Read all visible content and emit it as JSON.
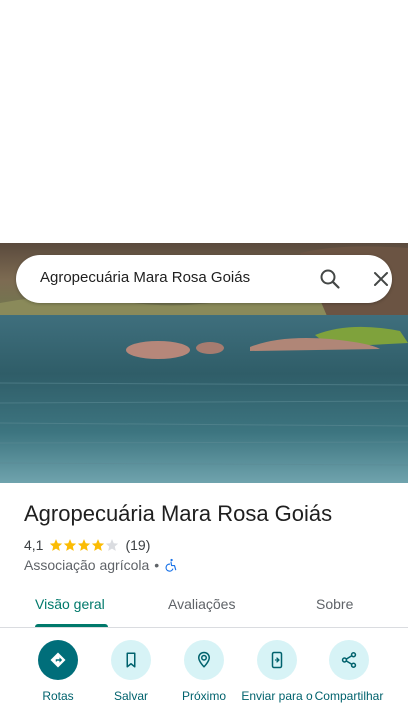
{
  "search": {
    "query": "Agropecuária Mara Rosa Goiás"
  },
  "place": {
    "title": "Agropecuária Mara Rosa Goiás",
    "rating": "4,1",
    "rating_stars": 4.1,
    "review_count": "(19)",
    "category": "Associação agrícola",
    "separator": "•"
  },
  "tabs": [
    {
      "label": "Visão geral",
      "active": true
    },
    {
      "label": "Avaliações",
      "active": false
    },
    {
      "label": "Sobre",
      "active": false
    }
  ],
  "actions": [
    {
      "label": "Rotas",
      "icon": "directions-icon"
    },
    {
      "label": "Salvar",
      "icon": "bookmark-icon"
    },
    {
      "label": "Próximo",
      "icon": "nearby-icon"
    },
    {
      "label": "Enviar para o",
      "icon": "send-to-phone-icon"
    },
    {
      "label": "Compartilhar",
      "icon": "share-icon"
    }
  ],
  "colors": {
    "accent": "#00796b",
    "action_primary": "#006e7a",
    "action_secondary": "#d7f3f6",
    "star": "#fbbc04",
    "accessibility": "#1a73e8"
  }
}
